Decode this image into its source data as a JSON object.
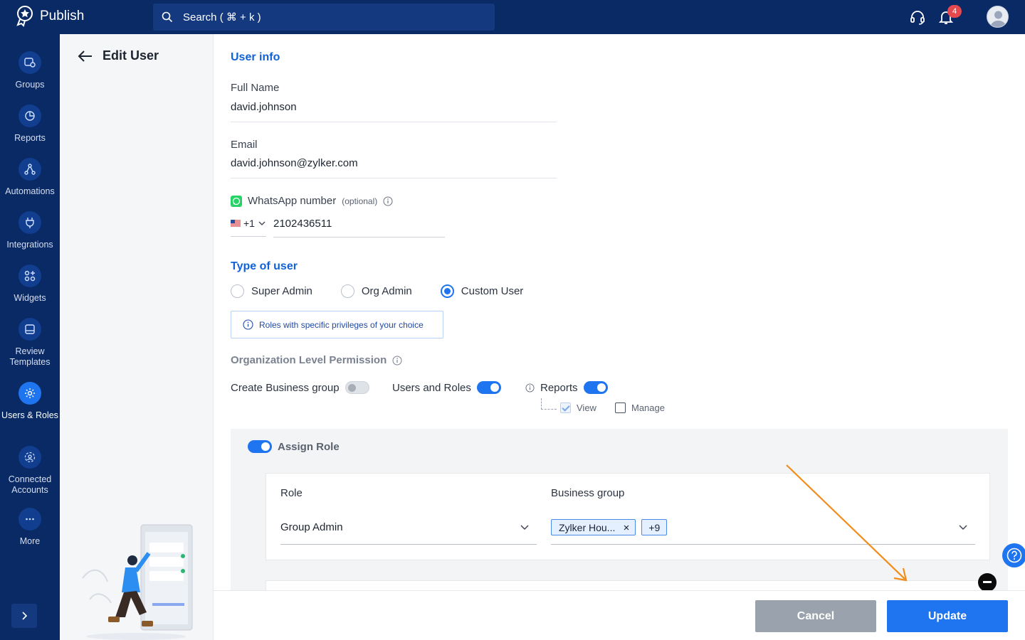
{
  "app": {
    "name": "Publish"
  },
  "search": {
    "placeholder": "Search ( ⌘ + k )"
  },
  "notifications": {
    "count": "4"
  },
  "sidebar": {
    "items": [
      {
        "label": "Groups",
        "icon": "groups-icon"
      },
      {
        "label": "Reports",
        "icon": "reports-icon"
      },
      {
        "label": "Automations",
        "icon": "automations-icon"
      },
      {
        "label": "Integrations",
        "icon": "integrations-icon"
      },
      {
        "label": "Widgets",
        "icon": "widgets-icon"
      },
      {
        "label": "Review Templates",
        "icon": "review-templates-icon"
      },
      {
        "label": "Users & Roles",
        "icon": "users-roles-icon",
        "active": true
      },
      {
        "label": "Connected Accounts",
        "icon": "connected-accounts-icon"
      },
      {
        "label": "More",
        "icon": "more-icon"
      }
    ]
  },
  "page": {
    "title": "Edit User"
  },
  "user_info": {
    "title": "User info",
    "full_name_label": "Full Name",
    "full_name": "david.johnson",
    "email_label": "Email",
    "email": "david.johnson@zylker.com",
    "whatsapp_label": "WhatsApp number",
    "optional": "(optional)",
    "country_code": "+1",
    "phone": "2102436511"
  },
  "user_type": {
    "title": "Type of user",
    "options": [
      "Super Admin",
      "Org Admin",
      "Custom User"
    ],
    "selected": "Custom User",
    "hint": "Roles with specific privileges of your choice"
  },
  "org_permission": {
    "title": "Organization Level Permission",
    "create_business_group": "Create Business group",
    "users_and_roles": "Users and Roles",
    "reports": "Reports",
    "view": "View",
    "manage": "Manage"
  },
  "assign_role": {
    "title": "Assign Role",
    "role_label": "Role",
    "role_value": "Group Admin",
    "business_group_label": "Business group",
    "chip": "Zylker Hou...",
    "more_count": "+9"
  },
  "footer": {
    "cancel": "Cancel",
    "update": "Update"
  },
  "colors": {
    "accent": "#1f75f0",
    "nav": "#0a2a66",
    "annotation": "#f28c1b"
  }
}
